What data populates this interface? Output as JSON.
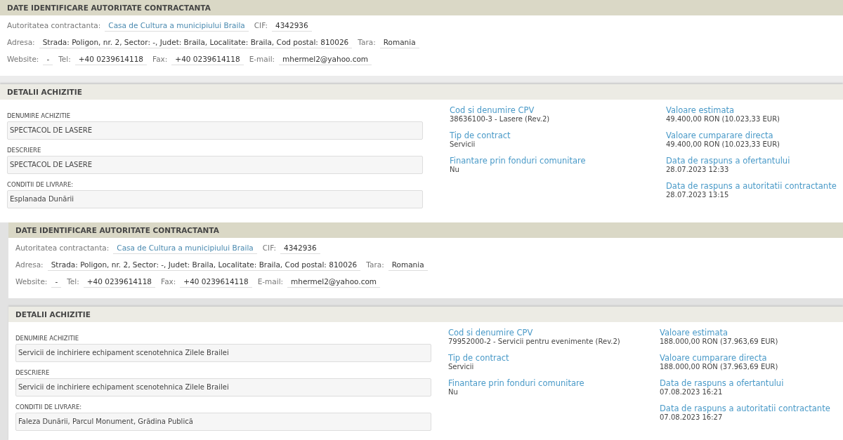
{
  "records": [
    {
      "authority": {
        "title": "DATE IDENTIFICARE AUTORITATE CONTRACTANTA",
        "lines": [
          {
            "pairs": [
              {
                "label": "Autoritatea contractanta:",
                "value": "Casa de Cultura a municipiului Braila",
                "kind": "link"
              },
              {
                "label": "CIF:",
                "value": "4342936",
                "kind": "plain"
              }
            ]
          },
          {
            "pairs": [
              {
                "label": "Adresa:",
                "value": "Strada: Poligon, nr. 2, Sector: -, Judet: Braila, Localitate: Braila, Cod postal: 810026",
                "kind": "plain"
              },
              {
                "label": "Tara:",
                "value": "Romania",
                "kind": "plain"
              }
            ]
          },
          {
            "pairs": [
              {
                "label": "Website:",
                "value": "-",
                "kind": "plain"
              },
              {
                "label": "Tel:",
                "value": "+40 0239614118",
                "kind": "plain"
              },
              {
                "label": "Fax:",
                "value": "+40 0239614118",
                "kind": "plain"
              },
              {
                "label": "E-mail:",
                "value": "mhermel2@yahoo.com",
                "kind": "plain"
              }
            ]
          }
        ]
      },
      "details": {
        "title": "DETALII ACHIZITIE",
        "fields": [
          {
            "label": "DENUMIRE ACHIZITIE",
            "value": "SPECTACOL DE LASERE"
          },
          {
            "label": "DESCRIERE",
            "value": "SPECTACOL DE LASERE"
          },
          {
            "label": "CONDITII DE LIVRARE:",
            "value": "Esplanada Dunării"
          }
        ],
        "middle": [
          {
            "label": "Cod si denumire CPV",
            "value": "38636100-3 - Lasere (Rev.2)"
          },
          {
            "label": "Tip de contract",
            "value": "Servicii"
          },
          {
            "label": "Finantare prin fonduri comunitare",
            "value": "Nu"
          }
        ],
        "right": [
          {
            "label": "Valoare estimata",
            "value": "49.400,00  RON (10.023,33  EUR)"
          },
          {
            "label": "Valoare cumparare directa",
            "value": "49.400,00  RON (10.023,33  EUR)"
          },
          {
            "label": "Data de raspuns a ofertantului",
            "value": "28.07.2023 12:33"
          },
          {
            "label": "Data de raspuns a autoritatii contractante",
            "value": "28.07.2023 13:15"
          }
        ]
      }
    },
    {
      "authority": {
        "title": "DATE IDENTIFICARE AUTORITATE CONTRACTANTA",
        "lines": [
          {
            "pairs": [
              {
                "label": "Autoritatea contractanta:",
                "value": "Casa de Cultura a municipiului Braila",
                "kind": "link"
              },
              {
                "label": "CIF:",
                "value": "4342936",
                "kind": "plain"
              }
            ]
          },
          {
            "pairs": [
              {
                "label": "Adresa:",
                "value": "Strada: Poligon, nr. 2, Sector: -, Judet: Braila, Localitate: Braila, Cod postal: 810026",
                "kind": "plain"
              },
              {
                "label": "Tara:",
                "value": "Romania",
                "kind": "plain"
              }
            ]
          },
          {
            "pairs": [
              {
                "label": "Website:",
                "value": "-",
                "kind": "plain"
              },
              {
                "label": "Tel:",
                "value": "+40 0239614118",
                "kind": "plain"
              },
              {
                "label": "Fax:",
                "value": "+40 0239614118",
                "kind": "plain"
              },
              {
                "label": "E-mail:",
                "value": "mhermel2@yahoo.com",
                "kind": "plain"
              }
            ]
          }
        ]
      },
      "details": {
        "title": "DETALII ACHIZITIE",
        "fields": [
          {
            "label": "DENUMIRE ACHIZITIE",
            "value": "Servicii de inchiriere echipament scenotehnica Zilele Brailei"
          },
          {
            "label": "DESCRIERE",
            "value": "Servicii de inchiriere echipament scenotehnica Zilele Brailei"
          },
          {
            "label": "CONDITII DE LIVRARE:",
            "value": "Faleza Dunării, Parcul Monument, Grădina Publică"
          }
        ],
        "middle": [
          {
            "label": "Cod si denumire CPV",
            "value": "79952000-2 - Servicii pentru evenimente (Rev.2)"
          },
          {
            "label": "Tip de contract",
            "value": "Servicii"
          },
          {
            "label": "Finantare prin fonduri comunitare",
            "value": "Nu"
          }
        ],
        "right": [
          {
            "label": "Valoare estimata",
            "value": "188.000,00  RON (37.963,69  EUR)"
          },
          {
            "label": "Valoare cumparare directa",
            "value": "188.000,00  RON (37.963,69  EUR)"
          },
          {
            "label": "Data de raspuns a ofertantului",
            "value": "07.08.2023 16:21"
          },
          {
            "label": "Data de raspuns a autoritatii contractante",
            "value": "07.08.2023 16:27"
          }
        ]
      }
    }
  ]
}
